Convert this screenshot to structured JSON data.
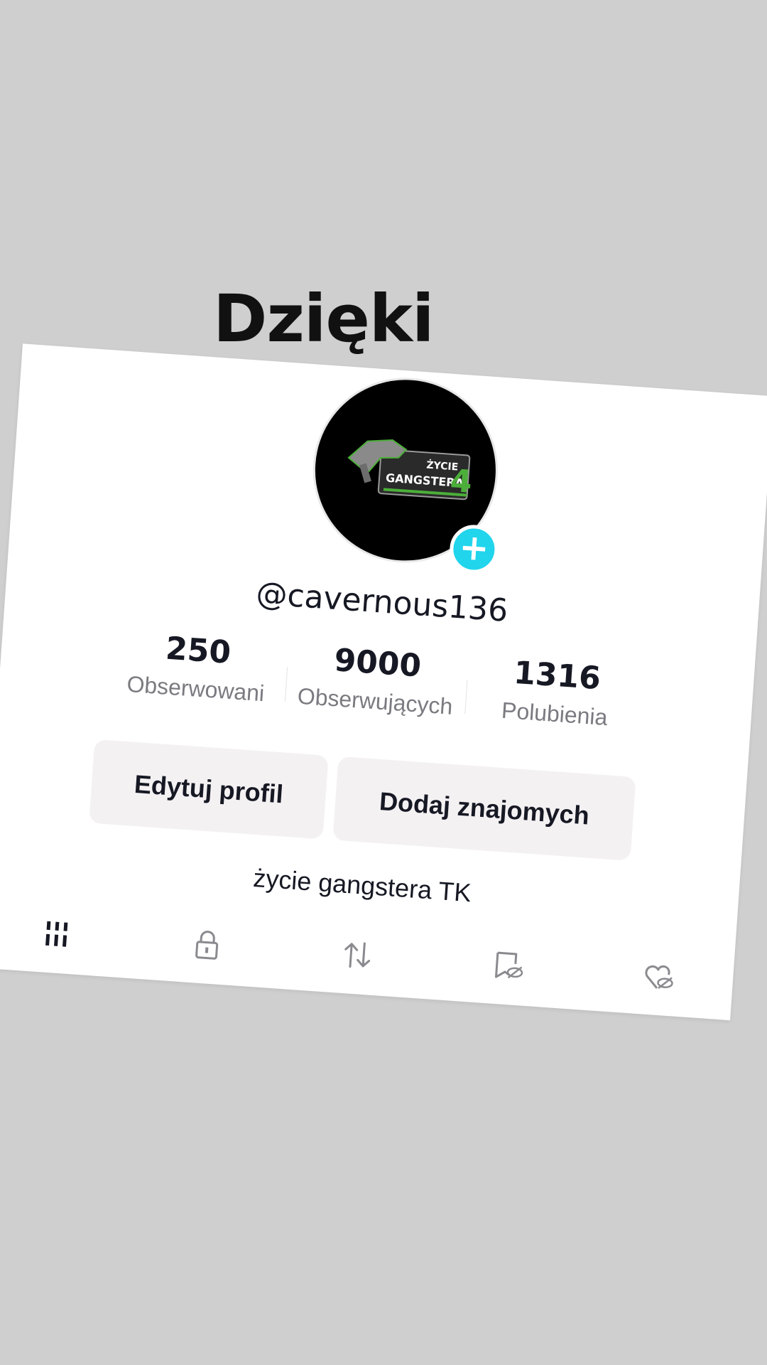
{
  "caption": "Dzięki",
  "profile": {
    "avatar_logo_text_line1": "ŻYCIE",
    "avatar_logo_text_line2": "GANGSTERA",
    "avatar_logo_number": "4",
    "username": "@cavernous136",
    "bio": "życie gangstera TK"
  },
  "stats": [
    {
      "value": "250",
      "label": "Obserwowani"
    },
    {
      "value": "9000",
      "label": "Obserwujących"
    },
    {
      "value": "1316",
      "label": "Polubienia"
    }
  ],
  "buttons": {
    "edit_profile": "Edytuj profil",
    "add_friends": "Dodaj znajomych"
  },
  "tabs": [
    {
      "icon": "grid-icon",
      "active": true
    },
    {
      "icon": "lock-icon",
      "active": false
    },
    {
      "icon": "repost-icon",
      "active": false
    },
    {
      "icon": "saved-hidden-icon",
      "active": false
    },
    {
      "icon": "liked-hidden-icon",
      "active": false
    }
  ],
  "colors": {
    "background": "#cfcfcf",
    "accent": "#20d5ec",
    "logo_green": "#4caf3a",
    "button_bg": "#f4f1f3"
  }
}
